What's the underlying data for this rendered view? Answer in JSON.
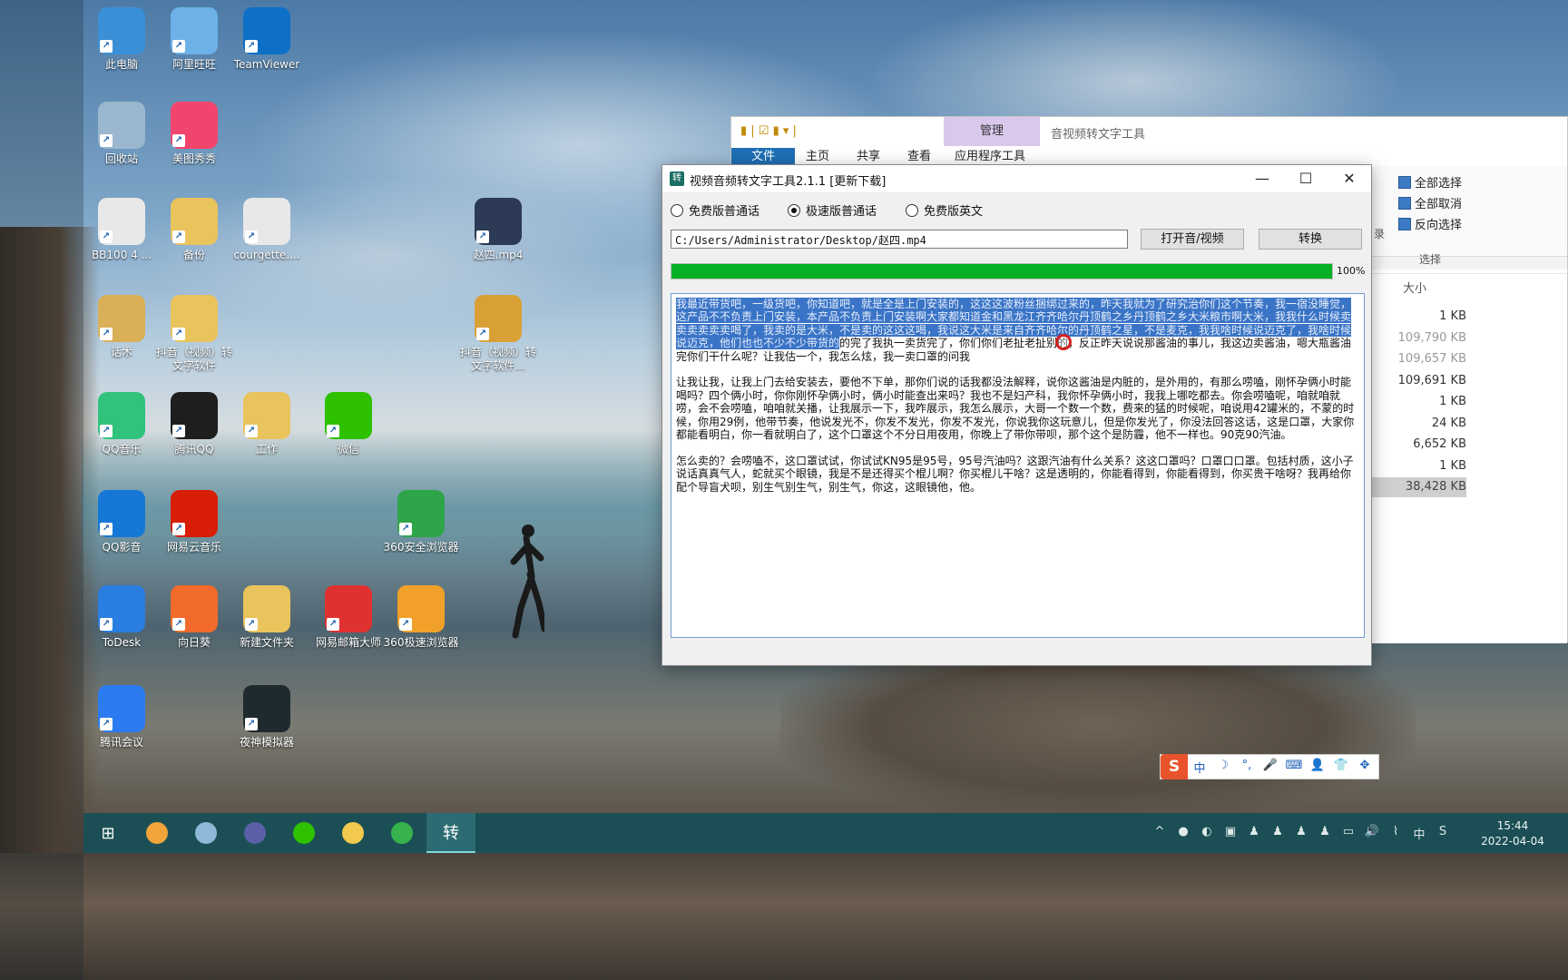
{
  "desktop_icons": [
    {
      "label": "此电脑",
      "icon": "computer-icon",
      "color": "#3a8fd6"
    },
    {
      "label": "阿里旺旺",
      "icon": "aliwangwang-icon",
      "color": "#6cb2e8"
    },
    {
      "label": "TeamViewer",
      "icon": "teamviewer-icon",
      "color": "#0e6fc7"
    },
    {
      "label": "回收站",
      "icon": "recycle-bin-icon",
      "color": "#9ab7cf"
    },
    {
      "label": "美图秀秀",
      "icon": "meitu-icon",
      "color": "#f2456e"
    },
    {
      "label": "BB100 4 ...",
      "icon": "file-icon",
      "color": "#e8e8e8"
    },
    {
      "label": "备份",
      "icon": "folder-icon",
      "color": "#e9c35b"
    },
    {
      "label": "courgette....",
      "icon": "file-icon",
      "color": "#e8e8e8"
    },
    {
      "label": "赵四.mp4",
      "icon": "video-file-icon",
      "color": "#2c3a55"
    },
    {
      "label": "话术",
      "icon": "book-icon",
      "color": "#d9b057"
    },
    {
      "label": "抖音（视频）转文字软件",
      "icon": "folder-icon",
      "color": "#e9c35b"
    },
    {
      "label": "抖音（视频）转文字软件...",
      "icon": "archive-icon",
      "color": "#d9a036"
    },
    {
      "label": "QQ音乐",
      "icon": "qq-music-icon",
      "color": "#31c27c"
    },
    {
      "label": "腾讯QQ",
      "icon": "qq-penguin-icon",
      "color": "#1e1e1e"
    },
    {
      "label": "工作",
      "icon": "folder-icon",
      "color": "#e9c35b"
    },
    {
      "label": "微信",
      "icon": "wechat-icon",
      "color": "#2dc100"
    },
    {
      "label": "QQ影音",
      "icon": "qq-player-icon",
      "color": "#1678d6"
    },
    {
      "label": "网易云音乐",
      "icon": "netease-music-icon",
      "color": "#d81e06"
    },
    {
      "label": "360安全浏览器",
      "icon": "browser-360-icon",
      "color": "#2fa54a"
    },
    {
      "label": "ToDesk",
      "icon": "todesk-icon",
      "color": "#2a7de1"
    },
    {
      "label": "向日葵",
      "icon": "sunlogin-icon",
      "color": "#f26b2a"
    },
    {
      "label": "新建文件夹",
      "icon": "folder-icon",
      "color": "#e9c35b"
    },
    {
      "label": "网易邮箱大师",
      "icon": "netease-mail-icon",
      "color": "#e03131"
    },
    {
      "label": "360极速浏览器",
      "icon": "browser-360-speed-icon",
      "color": "#f1a02a"
    },
    {
      "label": "腾讯会议",
      "icon": "tencent-meeting-icon",
      "color": "#2d7bf0"
    },
    {
      "label": "夜神模拟器",
      "icon": "nox-icon",
      "color": "#1f2a2e"
    }
  ],
  "explorer": {
    "manage_tab": "管理",
    "title": "音视频转文字工具",
    "tabs": [
      "文件",
      "主页",
      "共享",
      "查看",
      "应用程序工具"
    ],
    "select_all": "全部选择",
    "select_none": "全部取消",
    "invert_selection": "反向选择",
    "select_group": "选择",
    "partial_label": "录",
    "size_header": "大小",
    "sizes": [
      "1 KB",
      "109,790 KB",
      "109,657 KB",
      "109,691 KB",
      "1 KB",
      "24 KB",
      "6,652 KB",
      "1 KB",
      "38,428 KB"
    ]
  },
  "converter": {
    "title": "视频音频转文字工具2.1.1 [更新下载]",
    "minimize": "—",
    "maximize": "☐",
    "close": "✕",
    "options": [
      {
        "label": "免费版普通话",
        "checked": false
      },
      {
        "label": "极速版普通话",
        "checked": true
      },
      {
        "label": "免费版英文",
        "checked": false
      }
    ],
    "file_path": "C:/Users/Administrator/Desktop/赵四.mp4",
    "open_button": "打开音/视频",
    "convert_button": "转换",
    "progress": 1.0,
    "progress_label": "100%",
    "text_highlighted": "我最近带货吧，一级货吧，你知道吧，就是全是上门安装的，这这这波粉丝捆绑过来的，昨天我就为了研究治你们这个节奏，我一宿没睡觉，这产品不不负责上门安装，本产品不负责上门安装啊大家都知道金和黑龙江齐齐哈尔丹顶鹤之乡丹顶鹤之乡大米粮市啊大米，我我什么时候卖卖卖卖卖卖喝了，我卖的是大米，不是卖的这这这喝，我说这大米是来自齐齐哈尔的丹顶鹤之星，不是麦克，我我啥时候说迈克了，我啥时候说迈克，他们也也不少不少带货的",
    "text_rest": "的完了我执一卖货完了，你们你们老扯老扯别的，反正昨天说说那酱油的事儿，我这边卖酱油，嗯大瓶酱油完你们干什么呢？让我估一个，我怎么炫，我一卖口罩的问我",
    "paragraph2": "让我让我，让我上门去给安装去，要他不下单，那你们说的话我都没法解释，说你这酱油是内脏的，是外用的，有那么唠嗑，刚怀孕俩小时能喝吗？四个俩小时，你你刚怀孕俩小时，俩小时能查出来吗？我也不是妇产科，我你怀孕俩小时，我我上哪吃都去。你会唠嗑呢，咱就咱就唠，会不会唠嗑，咱咱就关播，让我展示一下，我咋展示，我怎么展示，大哥一个数一个数，费来的猛的时候呢，咱说用42罐米的，不蒙的时候，你用29例，他带节奏，他说发光不，你发不发光，你发不发光，你说我你这玩意儿，但是你发光了，你没法回答这话，这是口罩，大家你都能看明白，你一看就明白了，这个口罩这个不分日用夜用，你晚上了带你带呗，那个这个是防霾，他不一样也。90克90汽油。",
    "paragraph3": "怎么卖的？会唠嗑不，这口罩试试，你试试KN95是95号，95号汽油吗？这跟汽油有什么关系？这这口罩吗？口罩口口罩。包括村质，这小子说话真真气人，蛇就买个眼镜，我是不是还得买个棍儿啊？你买棍儿干啥？这是透明的，你能看得到，你能看得到，你买贵干啥呀？我再给你配个导盲犬呗，别生气别生气，别生气，你这，这眼镜他，他。"
  },
  "ime": {
    "logo": "S",
    "items": [
      "中",
      "☽",
      "°,",
      "🎤",
      "⌨",
      "👤",
      "👕",
      "✥"
    ]
  },
  "taskbar": {
    "apps": [
      {
        "icon": "windows-start-icon",
        "glyph": "⊞",
        "color": "#ffffff"
      },
      {
        "icon": "browser-icon",
        "glyph": "",
        "color": "#f0a43a"
      },
      {
        "icon": "aliwangwang-icon",
        "glyph": "",
        "color": "#8fb8d8"
      },
      {
        "icon": "app-icon",
        "glyph": "",
        "color": "#5a5fa8"
      },
      {
        "icon": "wechat-icon",
        "glyph": "",
        "color": "#2dc100"
      },
      {
        "icon": "file-explorer-icon",
        "glyph": "",
        "color": "#f2c94c"
      },
      {
        "icon": "browser-360-icon",
        "glyph": "",
        "color": "#37b24d"
      },
      {
        "icon": "converter-app-icon",
        "glyph": "转",
        "color": "#1b6e64"
      }
    ],
    "tray": [
      "^",
      "●",
      "◐",
      "▣",
      "♟",
      "♟",
      "♟",
      "♟",
      "▭",
      "🔊",
      "⌇",
      "中",
      "S"
    ],
    "time": "15:44",
    "date": "2022-04-04"
  }
}
